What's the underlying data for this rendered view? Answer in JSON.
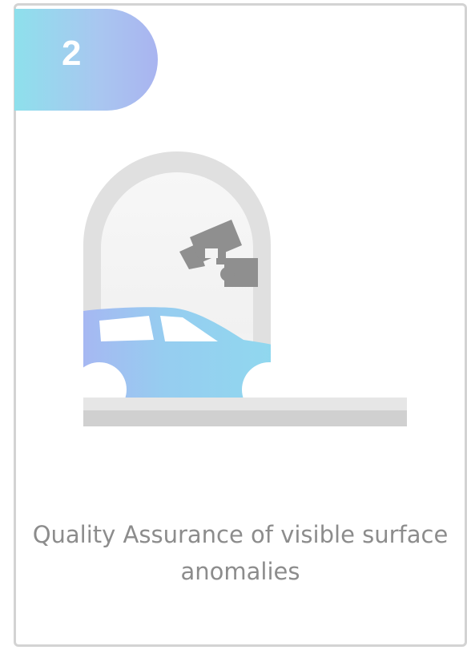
{
  "card": {
    "step_number": "2",
    "caption": "Quality Assurance of visible surface anomalies"
  },
  "illustration": {
    "icons": [
      "arch-icon",
      "security-camera-icon",
      "car-icon",
      "ground-platform-icon"
    ],
    "colors": {
      "arch": "#e0e0e0",
      "arch_inner": "#f5f5f5",
      "camera": "#8f8f8f",
      "car_gradient_start": "#a6b8f2",
      "car_gradient_end": "#8edcee",
      "ground": "#d0d0d0"
    }
  },
  "colors": {
    "badge_gradient_start": "#8ee0ec",
    "badge_gradient_end": "#a9b4f0",
    "caption_text": "#8c8c8c",
    "card_border": "#d3d3d3"
  }
}
